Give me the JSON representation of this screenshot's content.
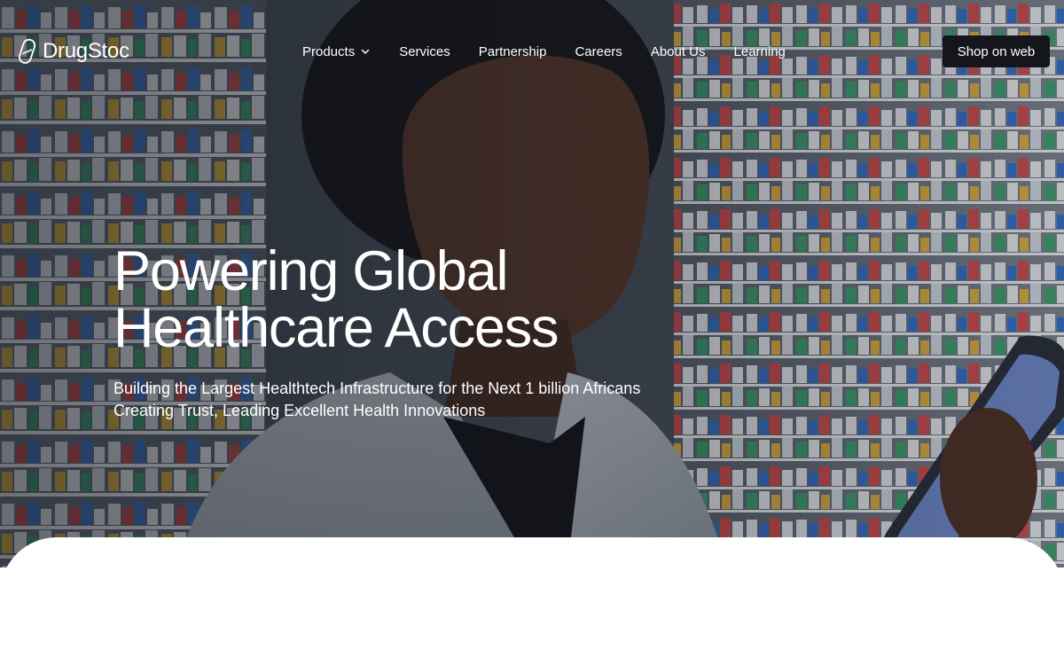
{
  "brand": {
    "name": "DrugStoc",
    "logo_icon": "pill-capsule-icon"
  },
  "nav": {
    "items": [
      {
        "label": "Products",
        "has_dropdown": true
      },
      {
        "label": "Services"
      },
      {
        "label": "Partnership"
      },
      {
        "label": "Careers"
      },
      {
        "label": "About Us"
      },
      {
        "label": "Learning"
      }
    ],
    "cta_label": "Shop on web"
  },
  "hero": {
    "title_line1": "Powering Global",
    "title_line2": "Healthcare Access",
    "subtitle_line1": "Building the Largest Healthtech Infrastructure for the Next 1 billion Africans",
    "subtitle_line2": "Creating Trust, Leading Excellent Health Innovations"
  },
  "colors": {
    "cta_background": "#15161c",
    "text_on_hero": "#ffffff",
    "panel": "#ffffff"
  }
}
